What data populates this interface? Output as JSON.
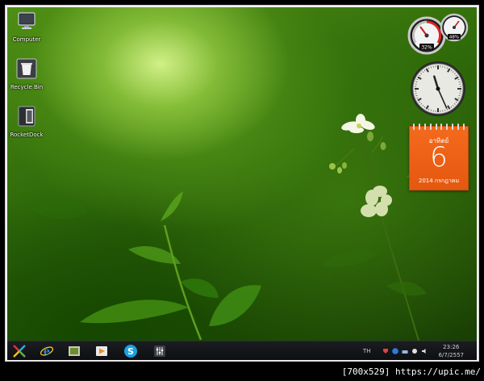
{
  "desktop": {
    "icons": [
      {
        "label": "Computer",
        "icon": "monitor-icon"
      },
      {
        "label": "Recycle Bin",
        "icon": "recycle-bin-icon"
      },
      {
        "label": "RocketDock",
        "icon": "rocketdock-icon"
      }
    ]
  },
  "gadgets": {
    "cpu_meter": {
      "left_value": "32%",
      "right_value": "48%",
      "cpu_percent": 32,
      "ram_percent": 48
    },
    "clock": {
      "hour": 11,
      "minute": 26
    },
    "calendar": {
      "day_name": "อาทิตย์",
      "day": "6",
      "month_year": "2014 กรกฎาคม"
    }
  },
  "taskbar": {
    "items": [
      {
        "icon": "start-x-icon"
      },
      {
        "icon": "internet-explorer-icon"
      },
      {
        "icon": "folder-icon"
      },
      {
        "icon": "media-player-icon"
      },
      {
        "icon": "skype-icon"
      },
      {
        "icon": "mixer-icon"
      }
    ],
    "language": "TH",
    "time": "23:26",
    "date": "6/7/2557"
  },
  "watermark": "[700x529] https://upic.me/",
  "colors": {
    "taskbar": "#111216",
    "calendar": "#ef6417",
    "accent_blue": "#1a8fe0"
  }
}
